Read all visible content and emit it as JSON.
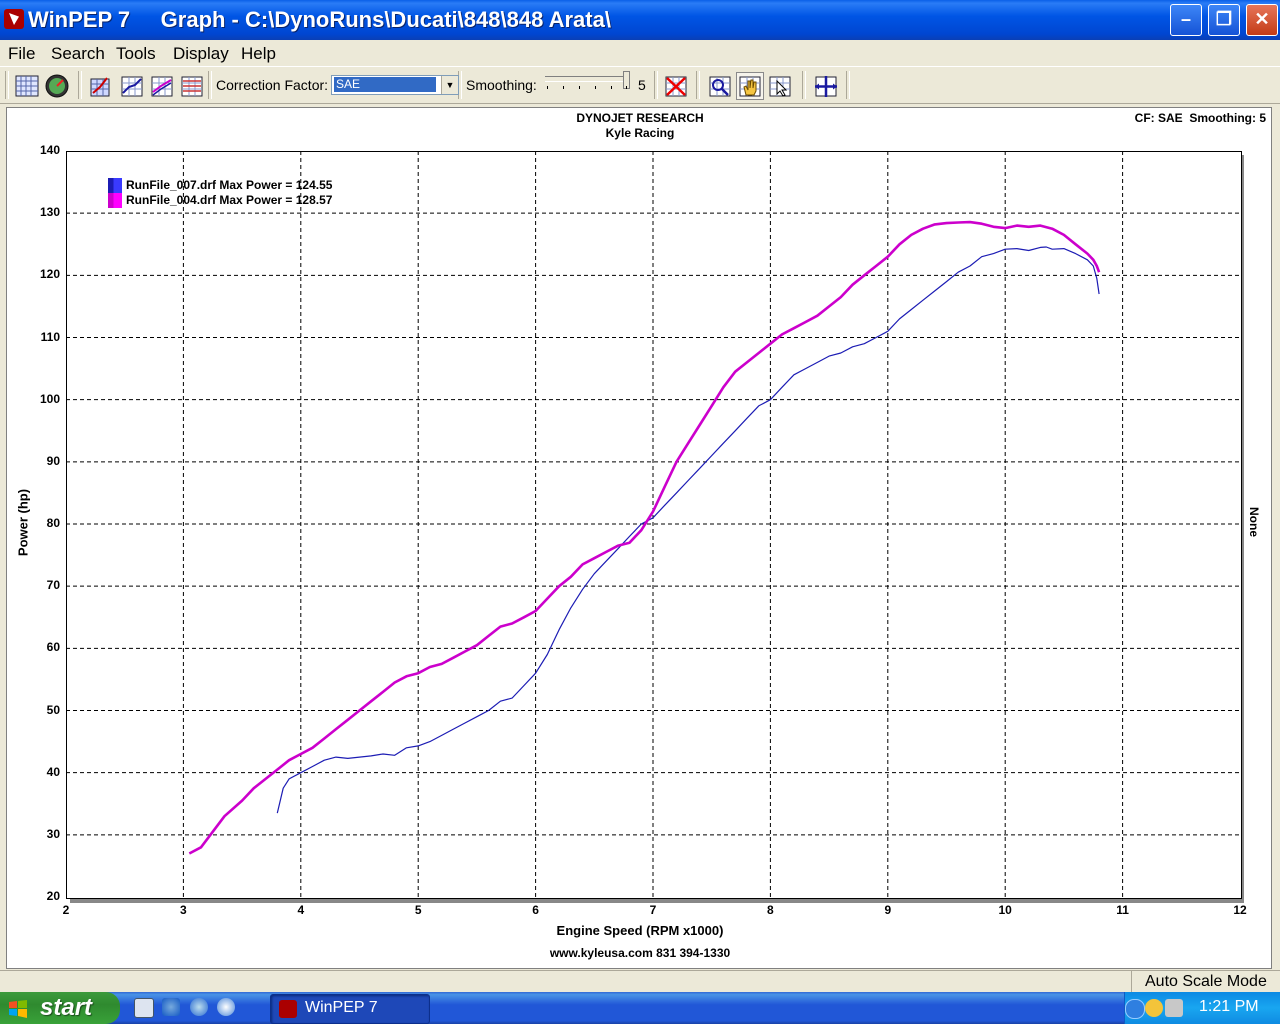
{
  "window": {
    "app_name": "WinPEP 7",
    "title": "WinPEP 7     Graph - C:\\DynoRuns\\Ducati\\848\\848 Arata\\"
  },
  "menu": [
    "File",
    "Search",
    "Tools",
    "Display",
    "Help"
  ],
  "toolbar": {
    "correction_factor_label": "Correction Factor:",
    "correction_factor_value": "SAE",
    "smoothing_label": "Smoothing:",
    "smoothing_value": "5",
    "icons": [
      "graph-grid-icon",
      "dyno-gauge-icon",
      "graph-3d-icon",
      "graph-line-icon",
      "graph-compare-icon",
      "graph-overlay-icon",
      "clear-red-x-icon",
      "zoom-grid-icon",
      "pan-hand-icon",
      "cursor-grid-icon",
      "crosshair-move-icon"
    ]
  },
  "graph": {
    "header_line1": "DYNOJET RESEARCH",
    "header_line2": "Kyle Racing",
    "cf_info": "CF: SAE  Smoothing: 5",
    "right_axis_label": "None",
    "footer": "www.kyleusa.com    831 394-1330"
  },
  "chart_data": {
    "type": "line",
    "title": "DYNOJET RESEARCH",
    "subtitle": "Kyle Racing",
    "xlabel": "Engine Speed  (RPM x1000)",
    "ylabel": "Power (hp)",
    "xlim": [
      2,
      12
    ],
    "ylim": [
      20,
      140
    ],
    "x_ticks": [
      "2",
      "3",
      "4",
      "5",
      "6",
      "7",
      "8",
      "9",
      "10",
      "11",
      "12"
    ],
    "y_ticks": [
      "20",
      "30",
      "40",
      "50",
      "60",
      "70",
      "80",
      "90",
      "100",
      "110",
      "120",
      "130",
      "140"
    ],
    "grid": true,
    "legend_position": "top-left",
    "series": [
      {
        "name": "RunFile_007.drf Max Power = 124.55",
        "color": "#1c1cb4",
        "swatch": "#3a3aff",
        "width": 1.2,
        "x": [
          3.8,
          3.85,
          3.9,
          4.0,
          4.1,
          4.2,
          4.3,
          4.4,
          4.5,
          4.6,
          4.7,
          4.8,
          4.9,
          5.0,
          5.1,
          5.2,
          5.3,
          5.4,
          5.5,
          5.6,
          5.7,
          5.8,
          5.9,
          6.0,
          6.1,
          6.2,
          6.3,
          6.4,
          6.5,
          6.6,
          6.7,
          6.8,
          6.9,
          7.0,
          7.1,
          7.2,
          7.3,
          7.4,
          7.5,
          7.6,
          7.7,
          7.8,
          7.9,
          8.0,
          8.1,
          8.2,
          8.3,
          8.4,
          8.5,
          8.6,
          8.7,
          8.8,
          8.9,
          9.0,
          9.1,
          9.2,
          9.3,
          9.4,
          9.5,
          9.6,
          9.7,
          9.8,
          9.9,
          10.0,
          10.1,
          10.2,
          10.3,
          10.35,
          10.4,
          10.5,
          10.6,
          10.7,
          10.75,
          10.78,
          10.8
        ],
        "y": [
          33.5,
          37.5,
          39,
          40,
          41,
          42,
          42.5,
          42.3,
          42.5,
          42.7,
          43,
          42.8,
          44,
          44.3,
          45,
          46,
          47,
          48,
          49,
          50,
          51.5,
          52,
          54,
          56,
          59,
          63,
          66.5,
          69.5,
          72,
          74,
          76,
          78,
          80,
          81,
          83,
          85,
          87,
          89,
          91,
          93,
          95,
          97,
          99,
          100,
          102,
          104,
          105,
          106,
          107,
          107.5,
          108.5,
          109,
          110,
          111,
          113,
          114.5,
          116,
          117.5,
          119,
          120.5,
          121.5,
          123,
          123.5,
          124.2,
          124.3,
          124,
          124.5,
          124.55,
          124.2,
          124.3,
          123.5,
          122.5,
          121.5,
          119.5,
          117
        ]
      },
      {
        "name": "RunFile_004.drf Max Power = 128.57",
        "color": "#cc00cc",
        "swatch": "#ff00ff",
        "width": 2.6,
        "x": [
          3.05,
          3.15,
          3.25,
          3.35,
          3.5,
          3.6,
          3.7,
          3.8,
          3.9,
          4.0,
          4.1,
          4.2,
          4.3,
          4.4,
          4.5,
          4.6,
          4.7,
          4.8,
          4.9,
          5.0,
          5.1,
          5.2,
          5.3,
          5.4,
          5.5,
          5.6,
          5.7,
          5.8,
          5.9,
          6.0,
          6.1,
          6.2,
          6.3,
          6.4,
          6.5,
          6.6,
          6.7,
          6.8,
          6.9,
          7.0,
          7.1,
          7.2,
          7.3,
          7.4,
          7.5,
          7.6,
          7.7,
          7.8,
          7.9,
          8.0,
          8.1,
          8.2,
          8.3,
          8.4,
          8.5,
          8.6,
          8.7,
          8.8,
          8.9,
          9.0,
          9.1,
          9.2,
          9.3,
          9.4,
          9.5,
          9.6,
          9.7,
          9.8,
          9.9,
          10.0,
          10.1,
          10.2,
          10.3,
          10.4,
          10.5,
          10.6,
          10.7,
          10.75,
          10.78,
          10.8
        ],
        "y": [
          27,
          28,
          30.5,
          33,
          35.5,
          37.5,
          39,
          40.5,
          42,
          43,
          44,
          45.5,
          47,
          48.5,
          50,
          51.5,
          53,
          54.5,
          55.5,
          56,
          57,
          57.5,
          58.5,
          59.5,
          60.5,
          62,
          63.5,
          64,
          65,
          66,
          68,
          70,
          71.5,
          73.5,
          74.5,
          75.5,
          76.5,
          77,
          79,
          82,
          86,
          90,
          93,
          96,
          99,
          102,
          104.5,
          106,
          107.5,
          109,
          110.5,
          111.5,
          112.5,
          113.5,
          115,
          116.5,
          118.5,
          120,
          121.5,
          123,
          125,
          126.5,
          127.5,
          128.2,
          128.4,
          128.5,
          128.57,
          128.3,
          127.8,
          127.6,
          128,
          127.8,
          128,
          127.5,
          126.5,
          125,
          123.5,
          122.5,
          121.5,
          120.5
        ]
      }
    ]
  },
  "statusbar": {
    "mode": "Auto Scale Mode"
  },
  "taskbar": {
    "start_label": "start",
    "task_label": "WinPEP 7",
    "clock": "1:21 PM"
  }
}
